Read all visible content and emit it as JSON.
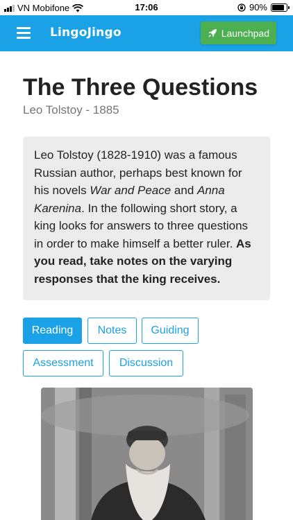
{
  "status_bar": {
    "carrier": "VN Mobifone",
    "time": "17:06",
    "battery_percent": "90%",
    "battery_level": 0.9
  },
  "app_bar": {
    "brand": "LingoJingo",
    "launchpad_label": "Launchpad",
    "background_color": "#1aa1e6",
    "launchpad_color": "#4caf50"
  },
  "story": {
    "title": "The Three Questions",
    "author_line": "Leo Tolstoy - 1885",
    "intro": {
      "part1": "Leo Tolstoy (1828-1910) was a famous Russian author, perhaps best known for his novels ",
      "novel1": "War and Peace",
      "and": " and ",
      "novel2": "Anna Karenina",
      "part2": ". In the following short story, a king looks for answers to three questions in order to make himself a better ruler. ",
      "emphasis": "As you read, take notes on the varying responses that the king receives."
    }
  },
  "tabs": [
    {
      "label": "Reading",
      "active": true
    },
    {
      "label": "Notes",
      "active": false
    },
    {
      "label": "Guiding",
      "active": false
    },
    {
      "label": "Assessment",
      "active": false
    },
    {
      "label": "Discussion",
      "active": false
    }
  ],
  "icons": {
    "menu": "hamburger-menu-icon",
    "launchpad": "rocket-icon",
    "signal": "cellular-signal-icon",
    "wifi": "wifi-icon",
    "orientation_lock": "orientation-lock-icon",
    "battery": "battery-icon"
  }
}
